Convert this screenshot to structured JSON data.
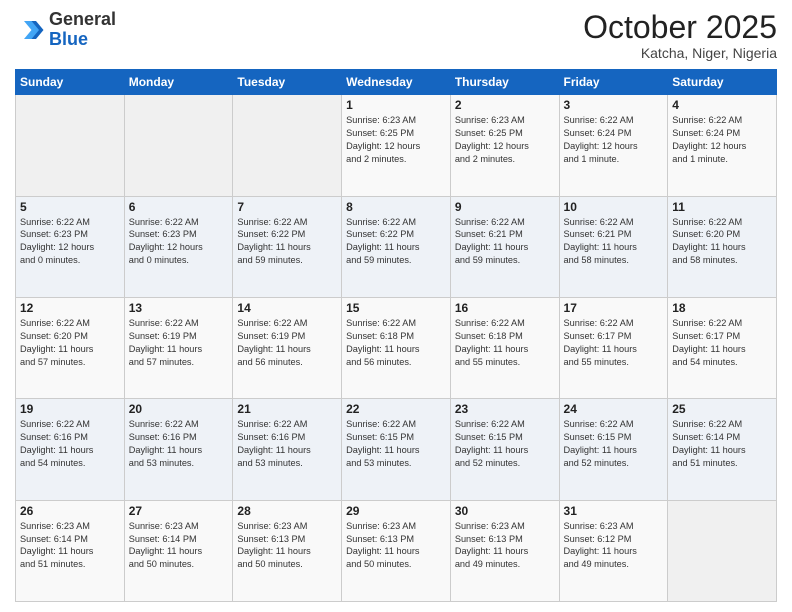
{
  "header": {
    "logo_line1": "General",
    "logo_line2": "Blue",
    "month": "October 2025",
    "location": "Katcha, Niger, Nigeria"
  },
  "weekdays": [
    "Sunday",
    "Monday",
    "Tuesday",
    "Wednesday",
    "Thursday",
    "Friday",
    "Saturday"
  ],
  "weeks": [
    [
      {
        "day": "",
        "info": ""
      },
      {
        "day": "",
        "info": ""
      },
      {
        "day": "",
        "info": ""
      },
      {
        "day": "1",
        "info": "Sunrise: 6:23 AM\nSunset: 6:25 PM\nDaylight: 12 hours\nand 2 minutes."
      },
      {
        "day": "2",
        "info": "Sunrise: 6:23 AM\nSunset: 6:25 PM\nDaylight: 12 hours\nand 2 minutes."
      },
      {
        "day": "3",
        "info": "Sunrise: 6:22 AM\nSunset: 6:24 PM\nDaylight: 12 hours\nand 1 minute."
      },
      {
        "day": "4",
        "info": "Sunrise: 6:22 AM\nSunset: 6:24 PM\nDaylight: 12 hours\nand 1 minute."
      }
    ],
    [
      {
        "day": "5",
        "info": "Sunrise: 6:22 AM\nSunset: 6:23 PM\nDaylight: 12 hours\nand 0 minutes."
      },
      {
        "day": "6",
        "info": "Sunrise: 6:22 AM\nSunset: 6:23 PM\nDaylight: 12 hours\nand 0 minutes."
      },
      {
        "day": "7",
        "info": "Sunrise: 6:22 AM\nSunset: 6:22 PM\nDaylight: 11 hours\nand 59 minutes."
      },
      {
        "day": "8",
        "info": "Sunrise: 6:22 AM\nSunset: 6:22 PM\nDaylight: 11 hours\nand 59 minutes."
      },
      {
        "day": "9",
        "info": "Sunrise: 6:22 AM\nSunset: 6:21 PM\nDaylight: 11 hours\nand 59 minutes."
      },
      {
        "day": "10",
        "info": "Sunrise: 6:22 AM\nSunset: 6:21 PM\nDaylight: 11 hours\nand 58 minutes."
      },
      {
        "day": "11",
        "info": "Sunrise: 6:22 AM\nSunset: 6:20 PM\nDaylight: 11 hours\nand 58 minutes."
      }
    ],
    [
      {
        "day": "12",
        "info": "Sunrise: 6:22 AM\nSunset: 6:20 PM\nDaylight: 11 hours\nand 57 minutes."
      },
      {
        "day": "13",
        "info": "Sunrise: 6:22 AM\nSunset: 6:19 PM\nDaylight: 11 hours\nand 57 minutes."
      },
      {
        "day": "14",
        "info": "Sunrise: 6:22 AM\nSunset: 6:19 PM\nDaylight: 11 hours\nand 56 minutes."
      },
      {
        "day": "15",
        "info": "Sunrise: 6:22 AM\nSunset: 6:18 PM\nDaylight: 11 hours\nand 56 minutes."
      },
      {
        "day": "16",
        "info": "Sunrise: 6:22 AM\nSunset: 6:18 PM\nDaylight: 11 hours\nand 55 minutes."
      },
      {
        "day": "17",
        "info": "Sunrise: 6:22 AM\nSunset: 6:17 PM\nDaylight: 11 hours\nand 55 minutes."
      },
      {
        "day": "18",
        "info": "Sunrise: 6:22 AM\nSunset: 6:17 PM\nDaylight: 11 hours\nand 54 minutes."
      }
    ],
    [
      {
        "day": "19",
        "info": "Sunrise: 6:22 AM\nSunset: 6:16 PM\nDaylight: 11 hours\nand 54 minutes."
      },
      {
        "day": "20",
        "info": "Sunrise: 6:22 AM\nSunset: 6:16 PM\nDaylight: 11 hours\nand 53 minutes."
      },
      {
        "day": "21",
        "info": "Sunrise: 6:22 AM\nSunset: 6:16 PM\nDaylight: 11 hours\nand 53 minutes."
      },
      {
        "day": "22",
        "info": "Sunrise: 6:22 AM\nSunset: 6:15 PM\nDaylight: 11 hours\nand 53 minutes."
      },
      {
        "day": "23",
        "info": "Sunrise: 6:22 AM\nSunset: 6:15 PM\nDaylight: 11 hours\nand 52 minutes."
      },
      {
        "day": "24",
        "info": "Sunrise: 6:22 AM\nSunset: 6:15 PM\nDaylight: 11 hours\nand 52 minutes."
      },
      {
        "day": "25",
        "info": "Sunrise: 6:22 AM\nSunset: 6:14 PM\nDaylight: 11 hours\nand 51 minutes."
      }
    ],
    [
      {
        "day": "26",
        "info": "Sunrise: 6:23 AM\nSunset: 6:14 PM\nDaylight: 11 hours\nand 51 minutes."
      },
      {
        "day": "27",
        "info": "Sunrise: 6:23 AM\nSunset: 6:14 PM\nDaylight: 11 hours\nand 50 minutes."
      },
      {
        "day": "28",
        "info": "Sunrise: 6:23 AM\nSunset: 6:13 PM\nDaylight: 11 hours\nand 50 minutes."
      },
      {
        "day": "29",
        "info": "Sunrise: 6:23 AM\nSunset: 6:13 PM\nDaylight: 11 hours\nand 50 minutes."
      },
      {
        "day": "30",
        "info": "Sunrise: 6:23 AM\nSunset: 6:13 PM\nDaylight: 11 hours\nand 49 minutes."
      },
      {
        "day": "31",
        "info": "Sunrise: 6:23 AM\nSunset: 6:12 PM\nDaylight: 11 hours\nand 49 minutes."
      },
      {
        "day": "",
        "info": ""
      }
    ]
  ]
}
